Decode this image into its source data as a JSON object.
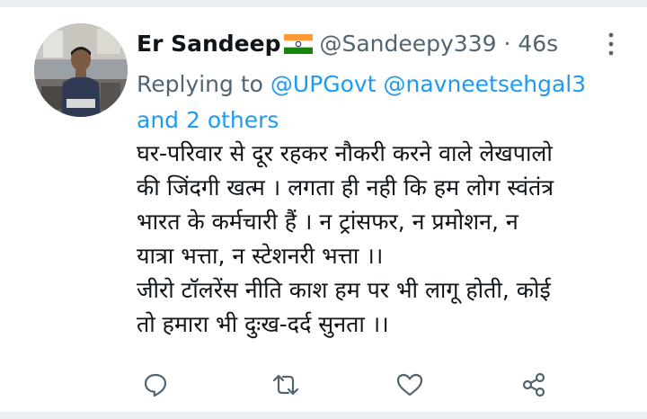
{
  "tweet": {
    "author_name": "Er Sandeep",
    "author_handle": "@Sandeepy339",
    "separator": " · ",
    "timestamp": "46s",
    "replying_prefix": "Replying to ",
    "reply_mention_1": "@UPGovt",
    "reply_mention_2": "@navneetsehgal3",
    "reply_others": "and 2 others",
    "text_lines": [
      "घर-परिवार से दूर रहकर नौकरी करने वाले लेखपालो",
      "की जिंदगी खत्म । लगता ही नही कि हम लोग स्वंतंत्र",
      "भारत के कर्मचारी हैं । न ट्रांसफर,  न प्रमोशन, न",
      "यात्रा भत्ता, न स्टेशनरी भत्ता ।।",
      "जीरो टॉलरेंस नीति काश हम पर भी लागू होती, कोई",
      "तो हमारा भी दुःख-दर्द सुनता ।।"
    ]
  },
  "icons": {
    "more": "more-vertical-icon",
    "reply": "reply-icon",
    "retweet": "retweet-icon",
    "like": "like-icon",
    "share": "share-icon",
    "flag": "india-flag-icon"
  },
  "colors": {
    "text_primary": "#0f1419",
    "text_secondary": "#536471",
    "link": "#1d9bf0",
    "flag_saffron": "#ff9933",
    "flag_green": "#138808",
    "flag_chakra": "#000080"
  }
}
